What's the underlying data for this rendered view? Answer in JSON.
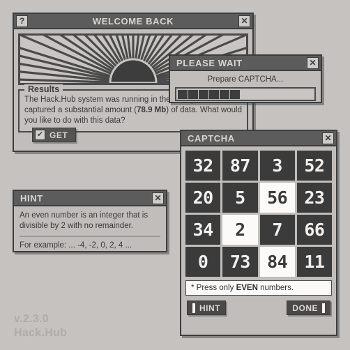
{
  "footer": {
    "version": "v.2.3.0",
    "brand": "Hack.Hub"
  },
  "welcome": {
    "title": "WELCOME BACK",
    "help_label": "?",
    "close_label": "✕",
    "results_legend": "Results",
    "results_text_1": "The Hack.Hub system was running in the background and",
    "results_text_2a": "captured a substantial amount (",
    "results_text_2b": "78.9 Mb",
    "results_text_2c": ") of data. What would",
    "results_text_3": "you like to do with this data?",
    "get_label": "GET",
    "check_glyph": "✔"
  },
  "wait": {
    "title": "PLEASE WAIT",
    "close_label": "✕",
    "message": "Prepare CAPTCHA...",
    "progress_blocks": 6,
    "progress_total": 22
  },
  "captcha": {
    "title": "CAPTCHA",
    "close_label": "✕",
    "grid": [
      {
        "value": "32",
        "selected": false
      },
      {
        "value": "87",
        "selected": false
      },
      {
        "value": "3",
        "selected": false
      },
      {
        "value": "52",
        "selected": false
      },
      {
        "value": "20",
        "selected": false
      },
      {
        "value": "5",
        "selected": false
      },
      {
        "value": "56",
        "selected": true
      },
      {
        "value": "23",
        "selected": false
      },
      {
        "value": "34",
        "selected": false
      },
      {
        "value": "2",
        "selected": true
      },
      {
        "value": "7",
        "selected": false
      },
      {
        "value": "66",
        "selected": false
      },
      {
        "value": "0",
        "selected": false
      },
      {
        "value": "73",
        "selected": false
      },
      {
        "value": "84",
        "selected": true
      },
      {
        "value": "11",
        "selected": false
      }
    ],
    "notice_pre": "* Press only ",
    "notice_em": "EVEN",
    "notice_post": " numbers.",
    "hint_button": "HINT",
    "done_button": "DONE"
  },
  "hint": {
    "title": "HINT",
    "close_label": "✕",
    "line_1": "An even number is an integer that is",
    "line_2": "divisible by 2 with no remainder.",
    "example": "For example: ... -4, -2, 0, 2, 4 ..."
  },
  "colors": {
    "desktop_bg": "#c5c2bf",
    "window_bg": "#c0bdba",
    "titlebar": "#5c5c5c",
    "border": "#3d3d3d",
    "cell_dark": "#3b3b3b",
    "cell_selected": "#fbfaf8",
    "footer_text": "#aeaba8"
  }
}
